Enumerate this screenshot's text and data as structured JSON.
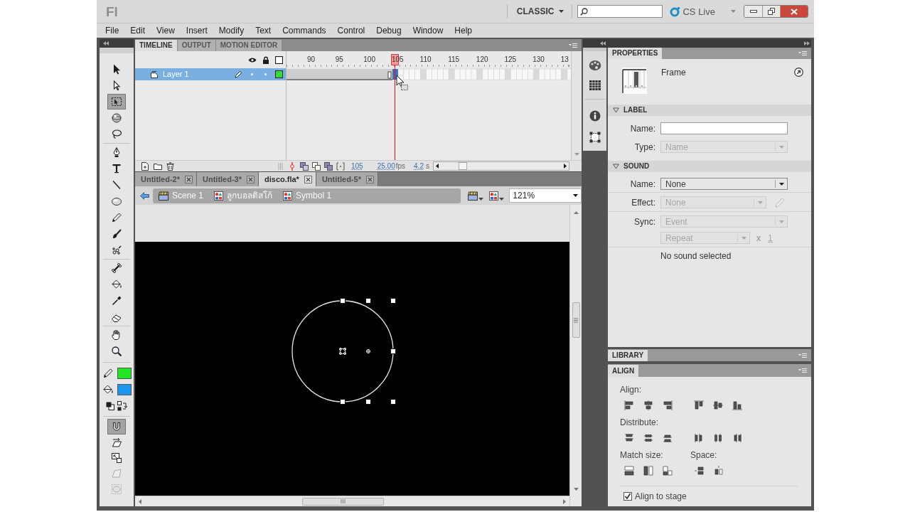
{
  "title_bar": {
    "logo": "Fl",
    "workspace": "CLASSIC",
    "cs_live": "CS Live"
  },
  "menu": [
    "File",
    "Edit",
    "View",
    "Insert",
    "Modify",
    "Text",
    "Commands",
    "Control",
    "Debug",
    "Window",
    "Help"
  ],
  "tools": [
    [
      {
        "kind": "selection",
        "selected": false
      },
      {
        "kind": "subselection",
        "selected": false
      },
      {
        "kind": "free_transform",
        "selected": true
      },
      {
        "kind": "rotation_3d",
        "selected": false
      },
      {
        "kind": "lasso",
        "selected": false
      }
    ],
    [
      {
        "kind": "pen",
        "selected": false
      },
      {
        "kind": "text",
        "selected": false
      },
      {
        "kind": "line",
        "selected": false
      },
      {
        "kind": "oval",
        "selected": false
      },
      {
        "kind": "pencil",
        "selected": false
      },
      {
        "kind": "brush",
        "selected": false
      },
      {
        "kind": "deco",
        "selected": false
      }
    ],
    [
      {
        "kind": "bone",
        "selected": false
      },
      {
        "kind": "paint_bucket",
        "selected": false
      },
      {
        "kind": "eyedropper",
        "selected": false
      },
      {
        "kind": "eraser",
        "selected": false
      }
    ],
    [
      {
        "kind": "hand",
        "selected": false
      },
      {
        "kind": "zoom",
        "selected": false
      }
    ]
  ],
  "color_swatches": [
    {
      "kind": "stroke",
      "color": "#22e622"
    },
    {
      "kind": "fill",
      "color": "#1e96f0"
    }
  ],
  "tool_options": [
    {
      "kind": "snap",
      "selected": true,
      "disabled": false
    },
    {
      "kind": "rotate_skew",
      "selected": false,
      "disabled": false
    },
    {
      "kind": "scale",
      "selected": false,
      "disabled": false
    },
    {
      "kind": "distort",
      "selected": false,
      "disabled": true
    },
    {
      "kind": "envelope",
      "selected": false,
      "disabled": true
    }
  ],
  "timeline": {
    "tabs": [
      {
        "label": "TIMELINE",
        "selected": true
      },
      {
        "label": "OUTPUT",
        "selected": false
      },
      {
        "label": "MOTION EDITOR",
        "selected": false
      }
    ],
    "frame_numbers": [
      {
        "label": "90",
        "selected": false
      },
      {
        "label": "95",
        "selected": false
      },
      {
        "label": "100",
        "selected": false
      },
      {
        "label": "105",
        "selected": true
      },
      {
        "label": "110",
        "selected": false
      },
      {
        "label": "115",
        "selected": false
      },
      {
        "label": "120",
        "selected": false
      },
      {
        "label": "125",
        "selected": false
      },
      {
        "label": "130",
        "selected": false
      },
      {
        "label": "13",
        "selected": false
      }
    ],
    "layers": [
      {
        "name": "Layer 1",
        "selected": true,
        "color": "#33dd33"
      }
    ],
    "current_frame": "105",
    "frame_rate": "25.00",
    "frame_rate_unit": "fps",
    "elapsed_time": "4.2",
    "elapsed_time_unit": "s"
  },
  "document_tabs": [
    {
      "label": "Untitled-2*",
      "selected": false
    },
    {
      "label": "Untitled-3*",
      "selected": false
    },
    {
      "label": "disco.fla*",
      "selected": true
    },
    {
      "label": "Untitled-5*",
      "selected": false
    }
  ],
  "edit_bar": {
    "breadcrumbs": [
      {
        "kind": "scene",
        "label": "Scene 1"
      },
      {
        "kind": "symbol",
        "label": "ลูกบอลดิสโก้"
      },
      {
        "kind": "symbol",
        "label": "Symbol 1"
      }
    ],
    "zoom": "121%"
  },
  "properties": {
    "tab": "PROPERTIES",
    "object_type": "Frame",
    "sections": [
      {
        "title": "LABEL",
        "expanded": true,
        "groups": [
          [
            {
              "kind": "text_input",
              "label": "Name:"
            },
            {
              "kind": "dropdown",
              "label": "Type:",
              "value": "Name",
              "disabled": true
            }
          ]
        ]
      },
      {
        "title": "SOUND",
        "expanded": true,
        "groups": [
          [
            {
              "kind": "dropdown",
              "label": "Name:",
              "value": "None",
              "disabled": false
            }
          ],
          [
            {
              "kind": "dropdown_edit",
              "label": "Effect:",
              "value": "None",
              "disabled": true
            }
          ],
          [
            {
              "kind": "dropdown",
              "label": "Sync:",
              "value": "Event",
              "disabled": true
            },
            {
              "kind": "repeat",
              "value": "Repeat",
              "times": "x",
              "count": "1",
              "disabled": true
            }
          ],
          [
            {
              "kind": "note",
              "text": "No sound selected"
            }
          ]
        ]
      }
    ]
  },
  "library": {
    "tab": "LIBRARY"
  },
  "align": {
    "tab": "ALIGN",
    "rows": [
      [
        {
          "label": "Align:",
          "buttons": [
            {
              "kind": "left_edge"
            },
            {
              "kind": "horizontal_center"
            },
            {
              "kind": "right_edge"
            },
            {
              "kind": "top_edge"
            },
            {
              "kind": "vertical_center"
            },
            {
              "kind": "bottom_edge"
            }
          ]
        }
      ],
      [
        {
          "label": "Distribute:",
          "buttons": [
            {
              "kind": "dist_top"
            },
            {
              "kind": "dist_vcenter"
            },
            {
              "kind": "dist_bottom"
            },
            {
              "kind": "dist_left"
            },
            {
              "kind": "dist_hcenter"
            },
            {
              "kind": "dist_right"
            }
          ]
        }
      ],
      [
        {
          "label": "Match size:",
          "buttons": [
            {
              "kind": "match_width"
            },
            {
              "kind": "match_height"
            },
            {
              "kind": "match_both"
            }
          ]
        },
        {
          "label": "Space:",
          "buttons": [
            {
              "kind": "space_vertical"
            },
            {
              "kind": "space_horizontal"
            }
          ]
        }
      ]
    ],
    "align_to_stage": {
      "label": "Align to stage",
      "checked": true
    }
  }
}
